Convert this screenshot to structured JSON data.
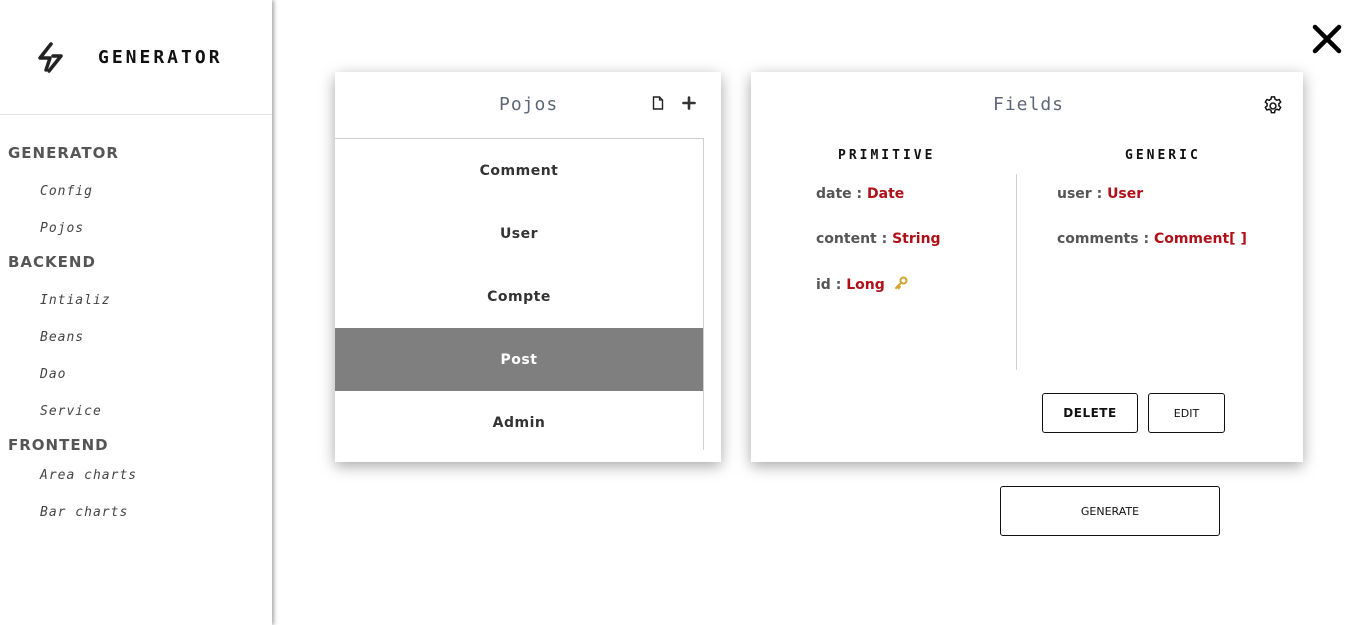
{
  "brand": {
    "title": "GENERATOR"
  },
  "sidebar": {
    "sections": [
      {
        "title": "GENERATOR",
        "items": [
          "Config",
          "Pojos"
        ]
      },
      {
        "title": "BACKEND",
        "items": [
          "Intializ",
          "Beans",
          "Dao",
          "Service"
        ]
      },
      {
        "title": "FRONTEND",
        "items": [
          "Area charts",
          "Bar charts"
        ]
      }
    ]
  },
  "pojos": {
    "title": "Pojos",
    "items": [
      "Comment",
      "User",
      "Compte",
      "Post",
      "Admin"
    ],
    "selected": "Post"
  },
  "fields": {
    "title": "Fields",
    "primitive_header": "PRIMITIVE",
    "generic_header": "GENERIC",
    "primitive": [
      {
        "name": "date",
        "type": "Date"
      },
      {
        "name": "content",
        "type": "String"
      },
      {
        "name": "id",
        "type": "Long",
        "icon": "key-icon"
      }
    ],
    "generic": [
      {
        "name": "user",
        "type": "User"
      },
      {
        "name": "comments",
        "type": "Comment[ ]"
      }
    ],
    "delete_label": "DELETE",
    "edit_label": "EDIT"
  },
  "generate_label": "GENERATE",
  "colors": {
    "type_text": "#b01018",
    "selected_row": "#7f7f7f",
    "title_text": "#5d6778"
  }
}
